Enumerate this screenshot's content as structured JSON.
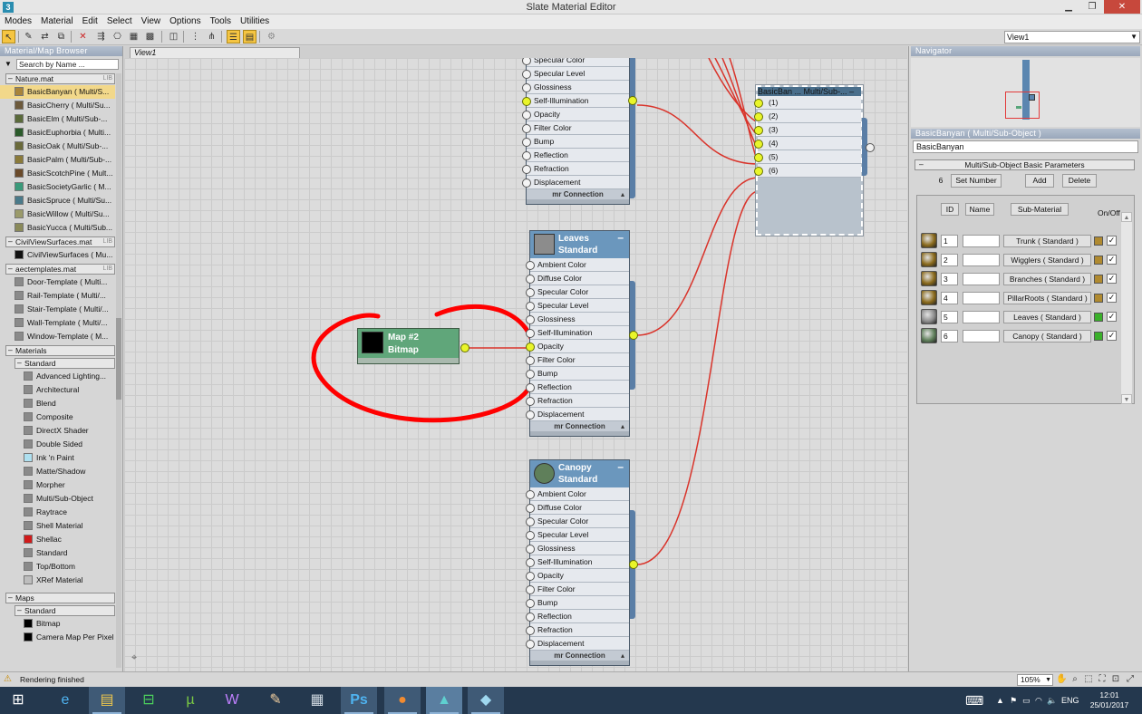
{
  "window": {
    "title": "Slate Material Editor",
    "minimize": "▁",
    "restore": "❐",
    "close": "✕"
  },
  "menu": [
    "Modes",
    "Material",
    "Edit",
    "Select",
    "View",
    "Options",
    "Tools",
    "Utilities"
  ],
  "toolbar": {
    "view_select": "View1"
  },
  "browser": {
    "title": "Material/Map Browser",
    "search_placeholder": "Search by Name ...",
    "lib_tag": "LIB",
    "nature_group": "Nature.mat",
    "nature_items": [
      {
        "label": "BasicBanyan  ( Multi/S...",
        "color": "#a8843a",
        "selected": true
      },
      {
        "label": "BasicCherry  ( Multi/Su...",
        "color": "#6d5a3c"
      },
      {
        "label": "BasicElm  ( Multi/Sub-...",
        "color": "#5a6a3a"
      },
      {
        "label": "BasicEuphorbia  ( Multi...",
        "color": "#2a5a2a"
      },
      {
        "label": "BasicOak  ( Multi/Sub-...",
        "color": "#6a6a3a"
      },
      {
        "label": "BasicPalm  ( Multi/Sub-...",
        "color": "#8a7a3a"
      },
      {
        "label": "BasicScotchPine  ( Mult...",
        "color": "#6a4a2a"
      },
      {
        "label": "BasicSocietyGarlic  ( M...",
        "color": "#3a9a7a"
      },
      {
        "label": "BasicSpruce  ( Multi/Su...",
        "color": "#4a7a8a"
      },
      {
        "label": "BasicWillow  ( Multi/Su...",
        "color": "#9a9a6a"
      },
      {
        "label": "BasicYucca  ( Multi/Sub...",
        "color": "#8a8a5a"
      }
    ],
    "civil_group": "CivilViewSurfaces.mat",
    "civil_items": [
      {
        "label": "CivilViewSurfaces  ( Mu...",
        "color": "#111111"
      }
    ],
    "aec_group": "aectemplates.mat",
    "aec_items": [
      {
        "label": "Door-Template  ( Multi...",
        "color": "#8a8a8a"
      },
      {
        "label": "Rail-Template  ( Multi/...",
        "color": "#8a8a8a"
      },
      {
        "label": "Stair-Template  ( Multi/...",
        "color": "#8a8a8a"
      },
      {
        "label": "Wall-Template  ( Multi/...",
        "color": "#8a8a8a"
      },
      {
        "label": "Window-Template  ( M...",
        "color": "#8a8a8a"
      }
    ],
    "materials_group": "Materials",
    "standard_sub": "Standard",
    "material_items": [
      {
        "label": "Advanced Lighting...",
        "color": "#8a8a8a"
      },
      {
        "label": "Architectural",
        "color": "#8a8a8a"
      },
      {
        "label": "Blend",
        "color": "#8a8a8a"
      },
      {
        "label": "Composite",
        "color": "#8a8a8a"
      },
      {
        "label": "DirectX Shader",
        "color": "#8a8a8a"
      },
      {
        "label": "Double Sided",
        "color": "#8a8a8a"
      },
      {
        "label": "Ink 'n Paint",
        "color": "#aee0f0"
      },
      {
        "label": "Matte/Shadow",
        "color": "#8a8a8a"
      },
      {
        "label": "Morpher",
        "color": "#8a8a8a"
      },
      {
        "label": "Multi/Sub-Object",
        "color": "#8a8a8a"
      },
      {
        "label": "Raytrace",
        "color": "#8a8a8a"
      },
      {
        "label": "Shell Material",
        "color": "#8a8a8a"
      },
      {
        "label": "Shellac",
        "color": "#d11a1a"
      },
      {
        "label": "Standard",
        "color": "#8a8a8a"
      },
      {
        "label": "Top/Bottom",
        "color": "#8a8a8a"
      },
      {
        "label": "XRef Material",
        "color": "#bdbdbd"
      }
    ],
    "maps_group": "Maps",
    "maps_sub": "Standard",
    "map_items": [
      {
        "label": "Bitmap",
        "color": "#000000"
      },
      {
        "label": "Camera Map Per Pixel",
        "color": "#000000"
      }
    ]
  },
  "view_tab": "View1",
  "slot_names": [
    "Ambient Color",
    "Diffuse Color",
    "Specular Color",
    "Specular Level",
    "Glossiness",
    "Self-Illumination",
    "Opacity",
    "Filter Color",
    "Bump",
    "Reflection",
    "Refraction",
    "Displacement"
  ],
  "mr_connection": "mr Connection",
  "nodes": {
    "top_partial": {
      "slots": [
        "Specular Color",
        "Specular Level",
        "Glossiness",
        "Self-Illumination",
        "Opacity",
        "Filter Color",
        "Bump",
        "Reflection",
        "Refraction",
        "Displacement"
      ]
    },
    "leaves": {
      "name": "Leaves",
      "type": "Standard",
      "thumb": "#8c8c8c"
    },
    "canopy": {
      "name": "Canopy",
      "type": "Standard",
      "thumb": "#5f7f5a"
    },
    "bitmap": {
      "name": "Map #2",
      "type": "Bitmap"
    },
    "multi": {
      "name": "BasicBan ...",
      "type": "Multi/Sub-...",
      "slots": [
        "(1)",
        "(2)",
        "(3)",
        "(4)",
        "(5)",
        "(6)"
      ]
    }
  },
  "navigator": {
    "title": "Navigator"
  },
  "params": {
    "title": "BasicBanyan  ( Multi/Sub-Object )",
    "name_value": "BasicBanyan",
    "rollout": "Multi/Sub-Object Basic Parameters",
    "count": "6",
    "set_number": "Set Number",
    "add": "Add",
    "delete": "Delete",
    "col_id": "ID",
    "col_name": "Name",
    "col_sub": "Sub-Material",
    "col_onoff": "On/Off",
    "rows": [
      {
        "id": "1",
        "material": "Trunk  ( Standard )",
        "ball": "#8a6a1c",
        "color": "#b08a30",
        "checked": "✓"
      },
      {
        "id": "2",
        "material": "Wigglers  ( Standard )",
        "ball": "#8a6a1c",
        "color": "#b08a30",
        "checked": "✓"
      },
      {
        "id": "3",
        "material": "Branches  ( Standard )",
        "ball": "#8a6a1c",
        "color": "#b08a30",
        "checked": "✓"
      },
      {
        "id": "4",
        "material": "PillarRoots  ( Standard )",
        "ball": "#8a6a1c",
        "color": "#b08a30",
        "checked": "✓"
      },
      {
        "id": "5",
        "material": "Leaves  ( Standard )",
        "ball": "#8c8c8c",
        "color": "#3ab02a",
        "checked": "✓"
      },
      {
        "id": "6",
        "material": "Canopy  ( Standard )",
        "ball": "#5f7f5a",
        "color": "#3ab02a",
        "checked": "✓"
      }
    ]
  },
  "status": {
    "text": "Rendering finished",
    "zoom": "105%"
  },
  "taskbar": {
    "lang": "ENG",
    "time": "12:01",
    "date": "25/01/2017"
  },
  "colors": {
    "wire": "#d9342b",
    "annotation": "#ff0000",
    "port": "#e9f52a"
  }
}
